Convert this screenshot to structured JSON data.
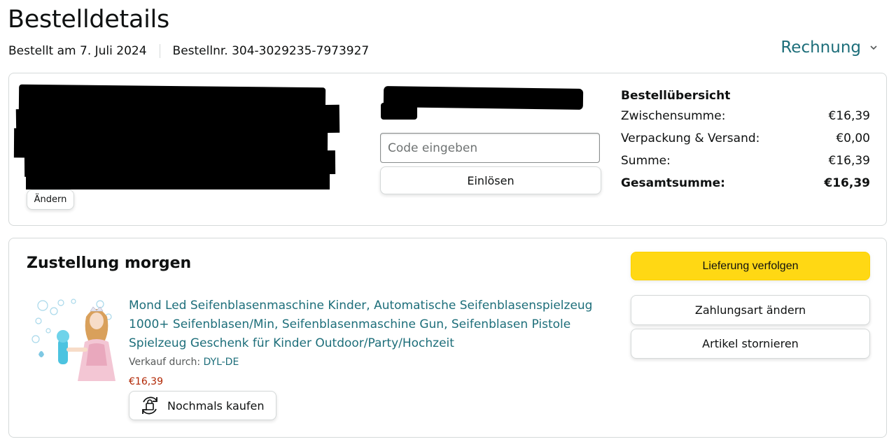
{
  "header": {
    "title": "Bestelldetails",
    "ordered_on": "Bestellt am 7. Juli 2024",
    "order_number": "Bestellnr. 304-3029235-7973927",
    "invoice_label": "Rechnung"
  },
  "address": {
    "change_label": "Ändern"
  },
  "gift": {
    "code_placeholder": "Code eingeben",
    "redeem_label": "Einlösen"
  },
  "summary": {
    "heading": "Bestellübersicht",
    "rows": [
      {
        "label": "Zwischensumme:",
        "value": "€16,39"
      },
      {
        "label": "Verpackung & Versand:",
        "value": "€0,00"
      },
      {
        "label": "Summe:",
        "value": "€16,39"
      },
      {
        "label": "Gesamtsumme:",
        "value": "€16,39"
      }
    ]
  },
  "delivery": {
    "title": "Zustellung morgen",
    "track_label": "Lieferung verfolgen",
    "payment_label": "Zahlungsart ändern",
    "cancel_label": "Artikel stornieren"
  },
  "item": {
    "title": "Mond Led Seifenblasenmaschine Kinder, Automatische Seifenblasenspielzeug 1000+ Seifenblasen/Min, Seifenblasenmaschine Gun, Seifenblasen Pistole Spielzeug Geschenk für Kinder Outdoor/Party/Hochzeit",
    "seller_prefix": "Verkauf durch:",
    "seller_name": "DYL-DE",
    "price": "€16,39",
    "rebuy_label": "Nochmals kaufen"
  },
  "colors": {
    "link": "#1d6e7a",
    "price": "#b12704",
    "primary_button": "#ffd814",
    "border": "#d5d9d9"
  }
}
